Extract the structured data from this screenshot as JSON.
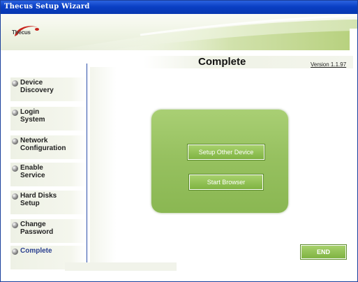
{
  "window": {
    "title": "Thecus Setup Wizard"
  },
  "banner": {
    "logo_text": "Thecus"
  },
  "sidebar": {
    "items": [
      {
        "label": "Device\nDiscovery",
        "active": false
      },
      {
        "label": "Login\nSystem",
        "active": false
      },
      {
        "label": "Network\nConfiguration",
        "active": false
      },
      {
        "label": "Enable\nService",
        "active": false
      },
      {
        "label": "Hard Disks\nSetup",
        "active": false
      },
      {
        "label": "Change\nPassword",
        "active": false
      },
      {
        "label": "Complete",
        "active": true
      }
    ]
  },
  "content": {
    "title": "Complete",
    "version": "Version 1.1.97",
    "setup_other_label": "Setup Other Device",
    "start_browser_label": "Start Browser",
    "end_label": "END"
  },
  "colors": {
    "titlebar": "#0a3fc4",
    "panel_green": "#97c160",
    "button_green": "#7fb342",
    "active_item_text": "#2a3f8f"
  }
}
